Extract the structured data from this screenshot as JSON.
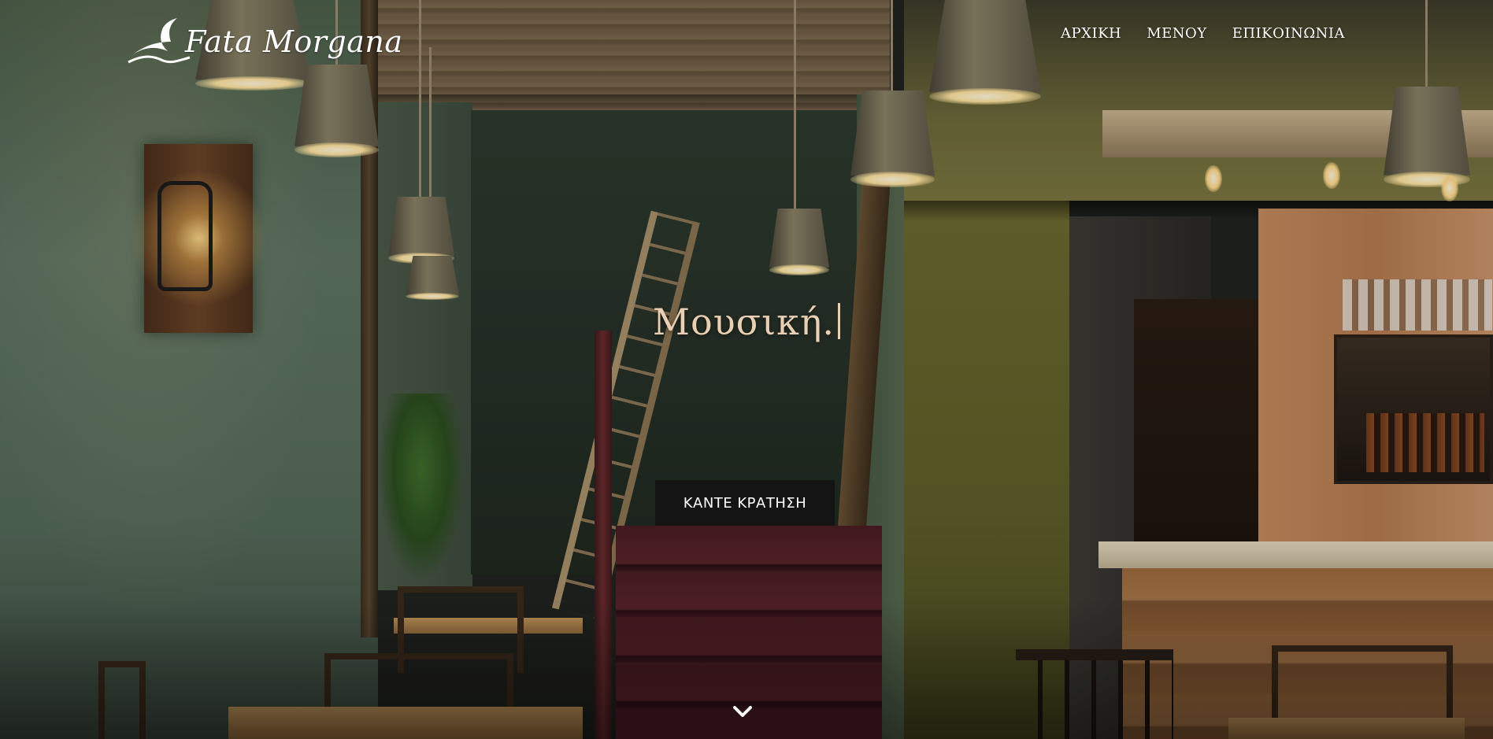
{
  "brand": {
    "logo_text": "Fata Morgana",
    "logo_icon": "bird-wing-icon"
  },
  "nav": {
    "items": [
      {
        "label": "ΑΡΧΙΚΗ"
      },
      {
        "label": "ΜΕΝΟΥ"
      },
      {
        "label": "ΕΠΙΚΟΙΝΩΝΙΑ"
      }
    ]
  },
  "hero": {
    "headline": "Μουσική.",
    "cta_label": "ΚΑΝΤΕ ΚΡΑΤΗΣΗ",
    "scroll_icon": "chevron-down-icon",
    "background": "restaurant-interior-photo"
  },
  "colors": {
    "headline": "#e9cfb4",
    "button_bg": "#141414",
    "nav_text": "#ffffff"
  }
}
